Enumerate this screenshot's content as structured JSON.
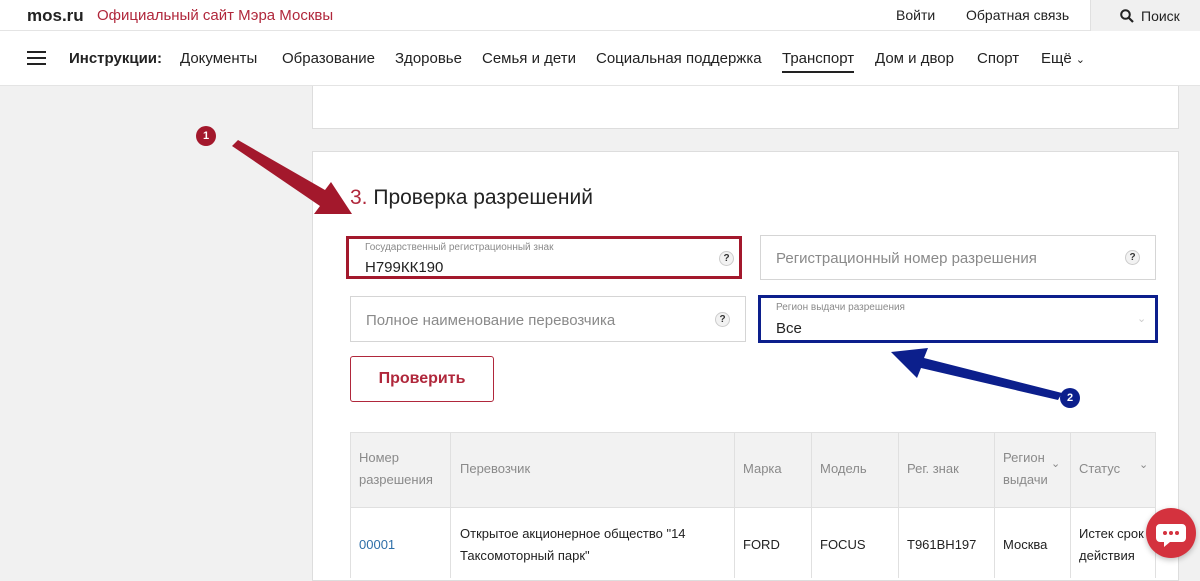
{
  "header": {
    "logo": "mos.ru",
    "site_title": "Официальный сайт Мэра Москвы",
    "login": "Войти",
    "feedback": "Обратная связь",
    "search": "Поиск"
  },
  "nav": {
    "label": "Инструкции:",
    "items": [
      "Документы",
      "Образование",
      "Здоровье",
      "Семья и дети",
      "Социальная поддержка",
      "Транспорт",
      "Дом и двор",
      "Спорт",
      "Ещё"
    ],
    "active": "Транспорт"
  },
  "section": {
    "number": "3.",
    "title": "Проверка разрешений"
  },
  "form": {
    "plate_label": "Государственный регистрационный знак",
    "plate_value": "Н799КК190",
    "permit_placeholder": "Регистрационный номер разрешения",
    "carrier_placeholder": "Полное наименование перевозчика",
    "region_label": "Регион выдачи разрешения",
    "region_value": "Все",
    "help": "?",
    "submit": "Проверить"
  },
  "table": {
    "headers": [
      "Номер разрешения",
      "Перевозчик",
      "Марка",
      "Модель",
      "Рег. знак",
      "Регион выдачи",
      "Статус"
    ],
    "header_lines": [
      [
        "Номер",
        "разрешения"
      ],
      [
        "Перевозчик"
      ],
      [
        "Марка"
      ],
      [
        "Модель"
      ],
      [
        "Рег. знак"
      ],
      [
        "Регион",
        "выдачи"
      ],
      [
        "Статус"
      ]
    ],
    "rows": [
      {
        "number": "00001",
        "carrier_lines": [
          "Открытое акционерное общество \"14",
          "Таксомоторный парк\""
        ],
        "brand": "FORD",
        "model": "FOCUS",
        "plate": "Т961ВН197",
        "region": "Москва",
        "status_lines": [
          "Истек срок",
          "действия"
        ]
      }
    ]
  },
  "annotations": {
    "badge1": "1",
    "badge2": "2",
    "red": "#a3182c",
    "blue": "#0c1f8c"
  },
  "colors": {
    "brand": "#b0273b",
    "link": "#2e6fa8"
  }
}
